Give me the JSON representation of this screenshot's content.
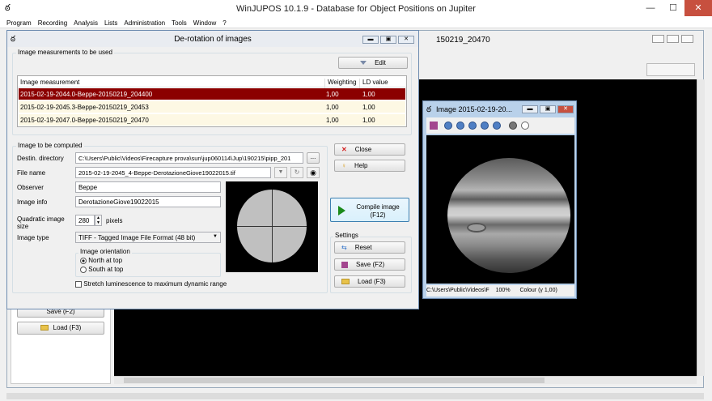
{
  "app": {
    "title": "WinJUPOS 10.1.9 - Database for Object Positions on Jupiter",
    "minimize": "—",
    "maximize": "☐",
    "close": "✕",
    "icon": "ఠ"
  },
  "menu": [
    "Program",
    "Recording",
    "Analysis",
    "Lists",
    "Administration",
    "Tools",
    "Window",
    "?"
  ],
  "bg_window": {
    "title": "150219_20470"
  },
  "bg_panel": {
    "save_partial": "Save (F2)",
    "load": "Load (F3)"
  },
  "dialog": {
    "title": "De-rotation of images",
    "measurements_group": "Image measurements to be used",
    "edit": "Edit",
    "table_headers": [
      "Image measurement",
      "Weighting",
      "LD value"
    ],
    "rows": [
      {
        "name": "2015-02-19-2044.0-Beppe-20150219_204400",
        "weighting": "1,00",
        "ld": "1,00"
      },
      {
        "name": "2015-02-19-2045.3-Beppe-20150219_20453",
        "weighting": "1,00",
        "ld": "1,00"
      },
      {
        "name": "2015-02-19-2047.0-Beppe-20150219_20470",
        "weighting": "1,00",
        "ld": "1,00"
      }
    ],
    "compute_group": "Image to be computed",
    "destin_label": "Destin. directory",
    "destin_value": "C:\\Users\\Public\\Videos\\Firecapture prova\\sun\\jup060114\\Jup\\190215\\pipp_201",
    "browse": "...",
    "filename_label": "File name",
    "filename_value": "2015-02-19-2045_4-Beppe-DerotazioneGiove19022015.tif",
    "observer_label": "Observer",
    "observer_value": "Beppe",
    "imageinfo_label": "Image info",
    "imageinfo_value": "DerotazioneGiove19022015",
    "size_label_1": "Quadratic image",
    "size_label_2": "size",
    "size_value": "280",
    "size_unit": "pixels",
    "type_label": "Image type",
    "type_value": "TIFF - Tagged Image File Format (48 bit)",
    "orientation_group": "Image orientation",
    "north": "North at top",
    "south": "South at top",
    "stretch": "Stretch luminescence to maximum dynamic range",
    "close": "Close",
    "help": "Help",
    "compile_1": "Compile image",
    "compile_2": "(F12)",
    "settings_group": "Settings",
    "reset": "Reset",
    "save": "Save (F2)",
    "load": "Load (F3)"
  },
  "image_window": {
    "title": "Image  2015-02-19-20...",
    "status_path": "C:\\Users\\Public\\Videos\\F",
    "zoom": "100%",
    "colour": "Colour (γ 1,00)"
  }
}
